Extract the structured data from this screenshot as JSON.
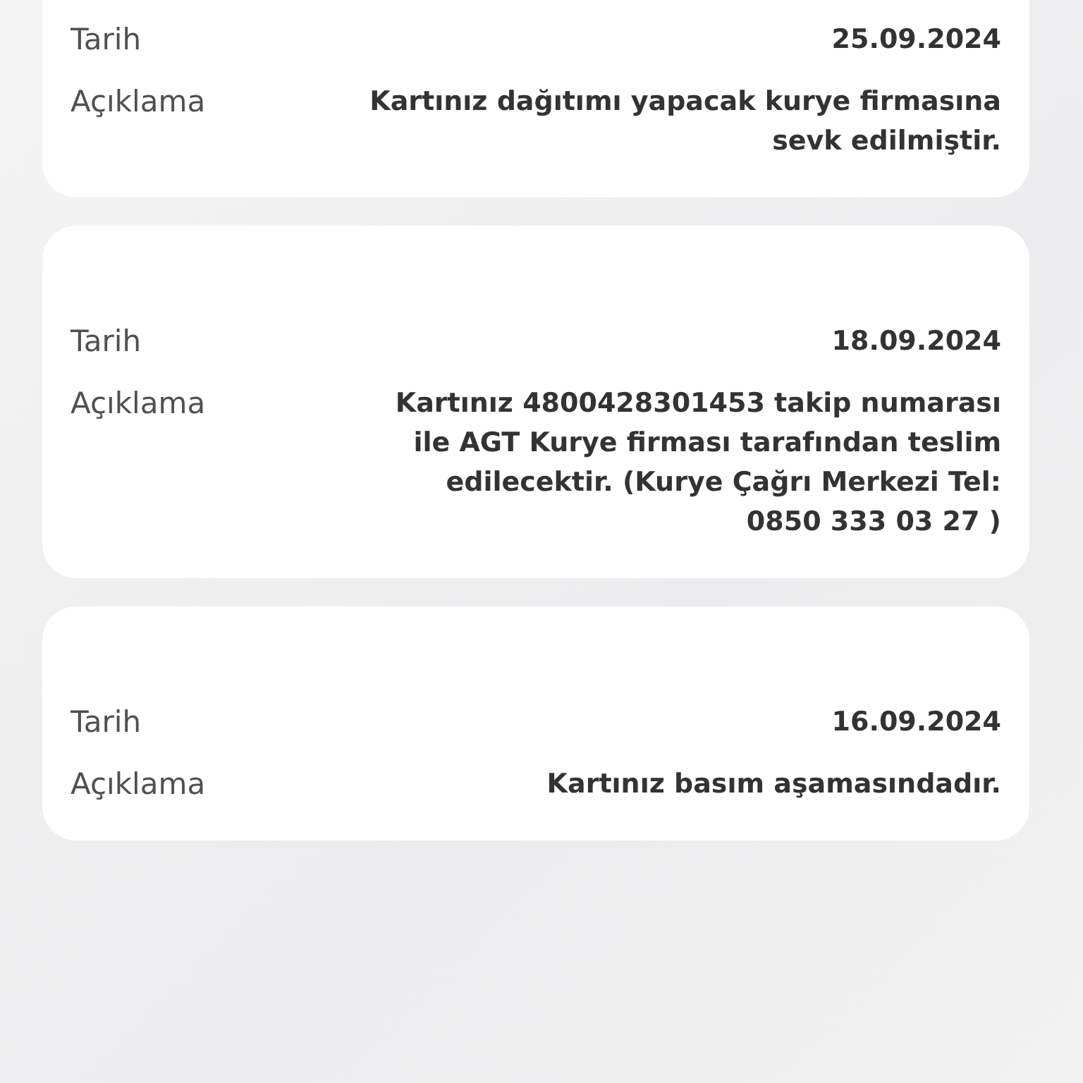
{
  "records": [
    {
      "rows": [
        {
          "label": "Tarih",
          "value": "25.09.2024"
        },
        {
          "label": "Açıklama",
          "value": "Kartınız dağıtımı yapacak kurye firmasına sevk edilmiştir."
        }
      ]
    },
    {
      "rows": [
        {
          "label": "Tarih",
          "value": "18.09.2024"
        },
        {
          "label": "Açıklama",
          "value": "Kartınız 4800428301453 takip numarası ile AGT Kurye firması tarafından teslim edilecektir. (Kurye Çağrı Merkezi Tel: 0850 333 03 27 )"
        }
      ]
    },
    {
      "rows": [
        {
          "label": "Tarih",
          "value": "16.09.2024"
        },
        {
          "label": "Açıklama",
          "value": "Kartınız basım aşamasındadır."
        }
      ]
    }
  ]
}
